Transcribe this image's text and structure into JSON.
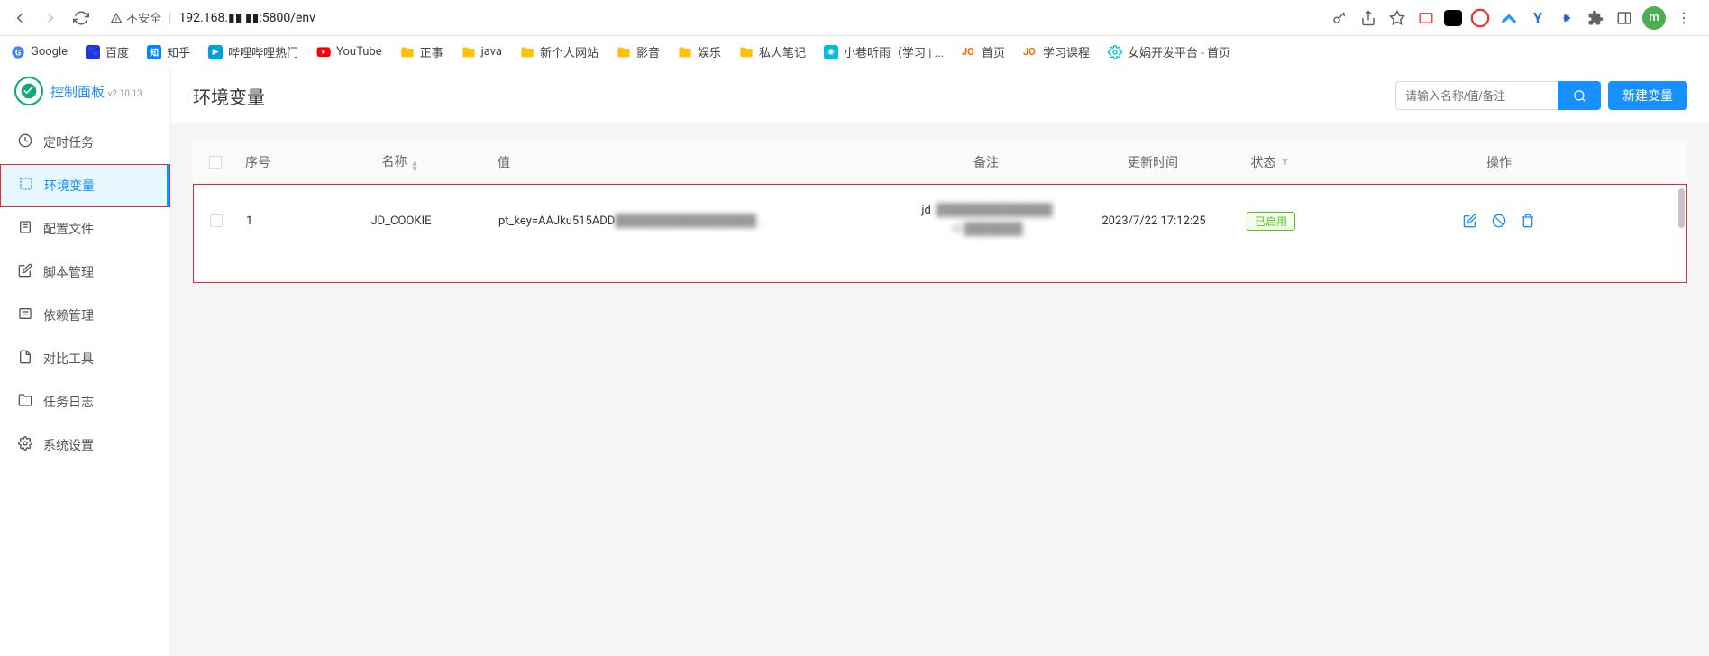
{
  "browser": {
    "insecure_label": "不安全",
    "url": "192.168.▮▮ ▮▮:5800/env",
    "avatar_letter": "m"
  },
  "bookmarks": [
    {
      "label": "Google",
      "icon": "google"
    },
    {
      "label": "百度",
      "icon": "baidu"
    },
    {
      "label": "知乎",
      "icon": "zhihu"
    },
    {
      "label": "哔哩哔哩热门",
      "icon": "bili"
    },
    {
      "label": "YouTube",
      "icon": "youtube"
    },
    {
      "label": "正事",
      "icon": "folder"
    },
    {
      "label": "java",
      "icon": "folder"
    },
    {
      "label": "新个人网站",
      "icon": "folder"
    },
    {
      "label": "影音",
      "icon": "folder"
    },
    {
      "label": "娱乐",
      "icon": "folder"
    },
    {
      "label": "私人笔记",
      "icon": "folder"
    },
    {
      "label": "小巷听雨（学习 | ...",
      "icon": "site"
    },
    {
      "label": "首页",
      "icon": "jo"
    },
    {
      "label": "学习课程",
      "icon": "jo"
    },
    {
      "label": "女娲开发平台 - 首页",
      "icon": "gear"
    }
  ],
  "sidebar": {
    "brand": "控制面板",
    "version": "v2.10.13",
    "items": [
      {
        "label": "定时任务"
      },
      {
        "label": "环境变量"
      },
      {
        "label": "配置文件"
      },
      {
        "label": "脚本管理"
      },
      {
        "label": "依赖管理"
      },
      {
        "label": "对比工具"
      },
      {
        "label": "任务日志"
      },
      {
        "label": "系统设置"
      }
    ]
  },
  "header": {
    "title": "环境变量",
    "search_placeholder": "请输入名称/值/备注",
    "new_button": "新建变量"
  },
  "table": {
    "columns": {
      "index": "序号",
      "name": "名称",
      "value": "值",
      "remark": "备注",
      "updated": "更新时间",
      "status": "状态",
      "action": "操作"
    },
    "rows": [
      {
        "index": "1",
        "name": "JD_COOKIE",
        "value_prefix": "pt_key=AAJku515ADD",
        "value_blur": "█████████████████...",
        "remark_prefix": "jd_",
        "remark_blur": "██████████████ 42███████",
        "updated": "2023/7/22 17:12:25",
        "status": "已启用"
      }
    ]
  }
}
